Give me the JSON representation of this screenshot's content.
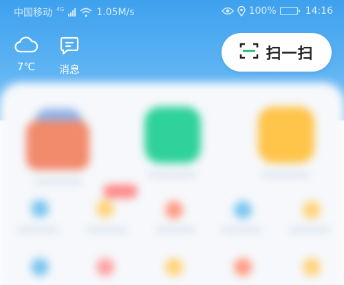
{
  "status_bar": {
    "carrier": "中国移动",
    "network_tag": "4G",
    "speed": "1.05M/s",
    "battery": "100%",
    "time": "14:16"
  },
  "header": {
    "weather_label": "7℃",
    "messages_label": "消息",
    "scan_label": "扫一扫"
  },
  "colors": {
    "header_blue": "#3ea1ee",
    "scan_accent": "#1fb86a"
  }
}
